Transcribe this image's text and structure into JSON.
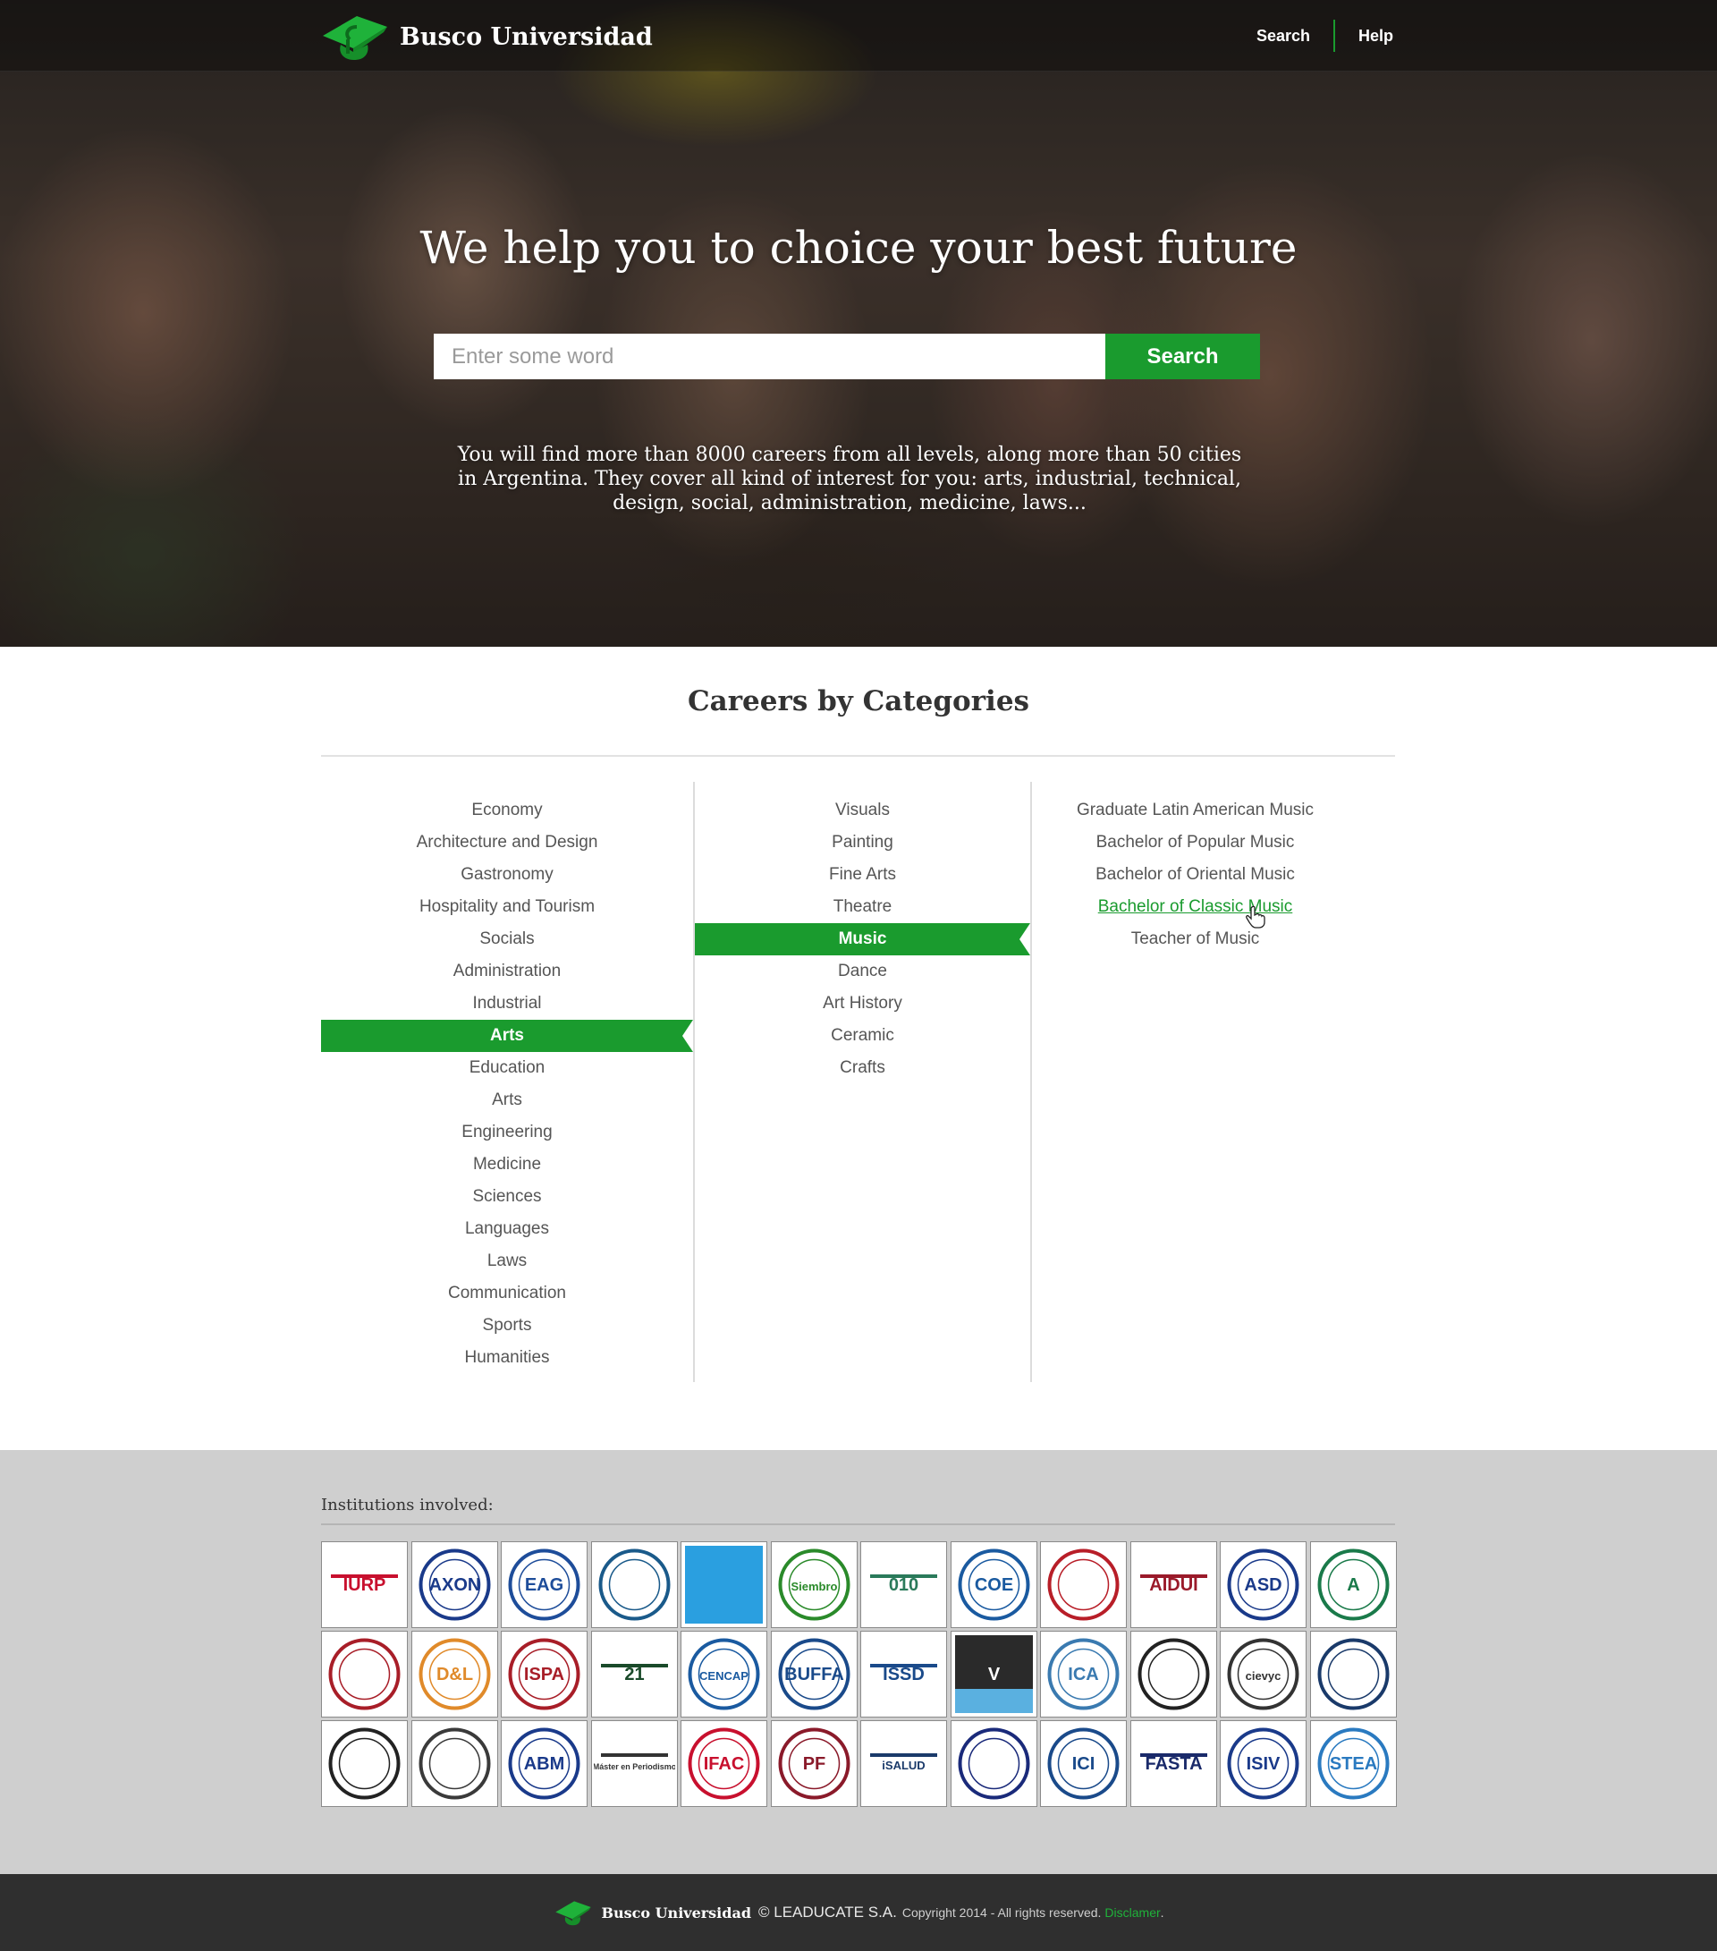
{
  "header": {
    "brand": "Busco Universidad",
    "nav": [
      "Search",
      "Help"
    ]
  },
  "hero": {
    "title": "We help you to choice your best future",
    "search_placeholder": "Enter some word",
    "search_button": "Search",
    "description": "You will find more than 8000 careers from all levels, along more than 50 cities in Argentina. They cover all kind of interest for you: arts, industrial, technical, design, social, administration, medicine, laws..."
  },
  "categories": {
    "title": "Careers by Categories",
    "column1": [
      "Economy",
      "Architecture and Design",
      "Gastronomy",
      "Hospitality and Tourism",
      "Socials",
      "Administration",
      "Industrial",
      "Arts",
      "Education",
      "Arts",
      "Engineering",
      "Medicine",
      "Sciences",
      "Languages",
      "Laws",
      "Communication",
      "Sports",
      "Humanities"
    ],
    "column1_selected": "Arts",
    "column2": [
      "Visuals",
      "Painting",
      "Fine Arts",
      "Theatre",
      "Music",
      "Dance",
      "Art History",
      "Ceramic",
      "Crafts"
    ],
    "column2_selected": "Music",
    "column3": [
      "Graduate Latin American Music",
      "Bachelor of Popular Music",
      "Bachelor of Oriental Music",
      "Bachelor of Classic Music",
      "Teacher of Music"
    ],
    "column3_hovered": "Bachelor of Classic Music"
  },
  "institutions": {
    "title": "Institutions involved:",
    "logos": [
      {
        "name": "iurp-logo",
        "text": "IURP",
        "color": "#c8102e"
      },
      {
        "name": "axon-logo",
        "text": "AXON",
        "color": "#1a3a8a"
      },
      {
        "name": "eag-logo",
        "text": "EAG",
        "color": "#1e4d9a"
      },
      {
        "name": "universidad-catolica-la-plata-logo",
        "text": "",
        "color": "#1a5a8a"
      },
      {
        "name": "blue-tile-logo",
        "text": "",
        "color": "#2a9fe0"
      },
      {
        "name": "siembro-logo",
        "text": "Siembro",
        "color": "#2a8a2a"
      },
      {
        "name": "universidad-caece-logo",
        "text": "010",
        "color": "#2a7a5a"
      },
      {
        "name": "coe-logo",
        "text": "COE",
        "color": "#1a5aa0"
      },
      {
        "name": "psicologia-social-logo",
        "text": "",
        "color": "#b81e28"
      },
      {
        "name": "aidui-logo",
        "text": "AIDUI",
        "color": "#9a1a2a"
      },
      {
        "name": "asd-logo",
        "text": "ASD",
        "color": "#1a3a8a"
      },
      {
        "name": "academia-green-logo",
        "text": "A",
        "color": "#1a7a4a"
      },
      {
        "name": "red-oval-logo",
        "text": "",
        "color": "#a81e28"
      },
      {
        "name": "dl-group-logo",
        "text": "D&L",
        "color": "#e08a2a"
      },
      {
        "name": "ispa-logo",
        "text": "ISPA",
        "color": "#a81e28"
      },
      {
        "name": "siglo-21-logo",
        "text": "21",
        "color": "#1a4a2a"
      },
      {
        "name": "cencap-logo",
        "text": "CENCAP",
        "color": "#1a5aa0"
      },
      {
        "name": "buffa-sistemas-logo",
        "text": "BUFFA",
        "color": "#1a4a8a"
      },
      {
        "name": "issd-logo",
        "text": "ISSD",
        "color": "#1a4a8a"
      },
      {
        "name": "vatel-logo",
        "text": "V",
        "color": "#222222"
      },
      {
        "name": "ica-logo",
        "text": "ICA",
        "color": "#3a7ab0"
      },
      {
        "name": "universidad-nacional-rosario-logo",
        "text": "",
        "color": "#222222"
      },
      {
        "name": "cievyc-logo",
        "text": "cievyc",
        "color": "#333333"
      },
      {
        "name": "instituto-privado-logo",
        "text": "",
        "color": "#1a3a6a"
      },
      {
        "name": "unr-seal-logo",
        "text": "",
        "color": "#222222"
      },
      {
        "name": "swoosh-logo",
        "text": "",
        "color": "#3a3a3a"
      },
      {
        "name": "abm-logo",
        "text": "ABM",
        "color": "#1a3a8a"
      },
      {
        "name": "master-periodismo-logo",
        "text": "Máster en Periodismo",
        "color": "#333333"
      },
      {
        "name": "ifac-logo",
        "text": "IFAC",
        "color": "#c8102e"
      },
      {
        "name": "fundacion-pierre-fauchard-logo",
        "text": "PF",
        "color": "#8a1a2a"
      },
      {
        "name": "isalud-logo",
        "text": "iSALUD",
        "color": "#1a3a6a"
      },
      {
        "name": "cross-seal-logo",
        "text": "",
        "color": "#1a2a7a"
      },
      {
        "name": "ici-logo",
        "text": "ICI",
        "color": "#1a4a8a"
      },
      {
        "name": "fasta-logo",
        "text": "FASTA",
        "color": "#1a2a6a"
      },
      {
        "name": "isiv-logo",
        "text": "ISIV",
        "color": "#1a3a8a"
      },
      {
        "name": "stea-logo",
        "text": "STEA",
        "color": "#2a7ac0"
      }
    ]
  },
  "footer": {
    "brand": "Busco Universidad",
    "company": "© LEADUCATE S.A.",
    "rights": "Copyright 2014 - All rights reserved.",
    "link": "Disclamer",
    "period": "."
  },
  "colors": {
    "accent": "#1a9b2e",
    "footer_bg": "#2f2f2f",
    "institutions_bg": "#cfcfcf"
  }
}
